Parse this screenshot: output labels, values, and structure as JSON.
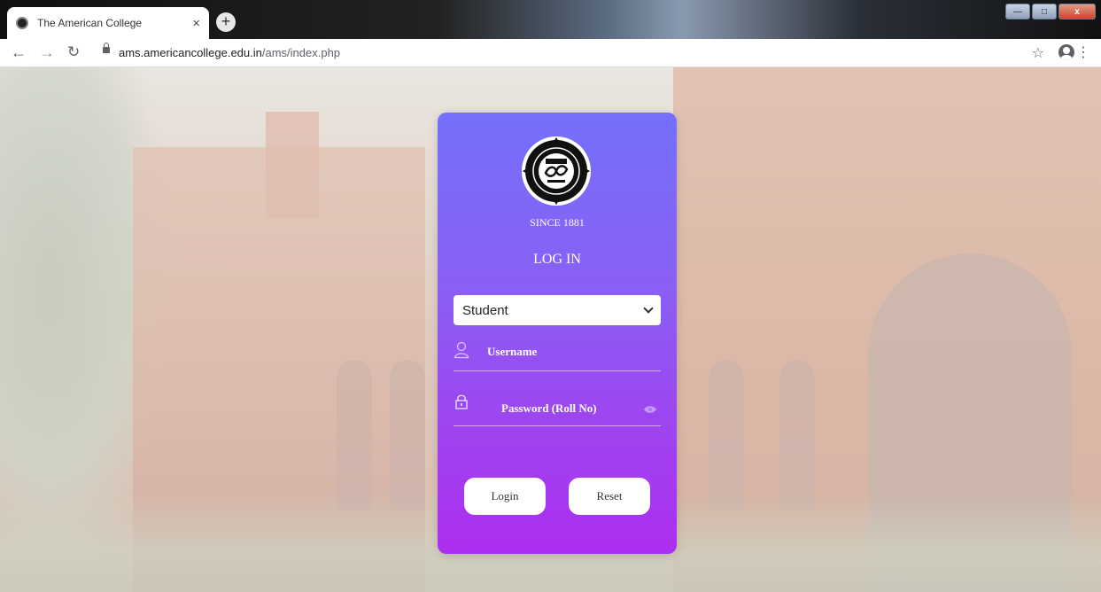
{
  "browser": {
    "tab_title": "The American College",
    "tab_close": "×",
    "new_tab": "+",
    "url_host": "ams.americancollege.edu.in",
    "url_path": "/ams/index.php",
    "icons": [
      "favicon-icon",
      "back-icon",
      "forward-icon",
      "reload-icon",
      "lock-icon",
      "star-icon",
      "profile-icon",
      "menu-icon",
      "minimize-icon",
      "maximize-icon",
      "close-icon"
    ]
  },
  "login_card": {
    "since": "SINCE 1881",
    "heading": "LOG IN",
    "role_select": {
      "selected": "Student"
    },
    "username_placeholder": "Username",
    "password_placeholder": "Password (Roll No)",
    "login_label": "Login",
    "reset_label": "Reset",
    "colors": {
      "gradient_top": "#7470fb",
      "gradient_bottom": "#ad2ef0"
    }
  }
}
